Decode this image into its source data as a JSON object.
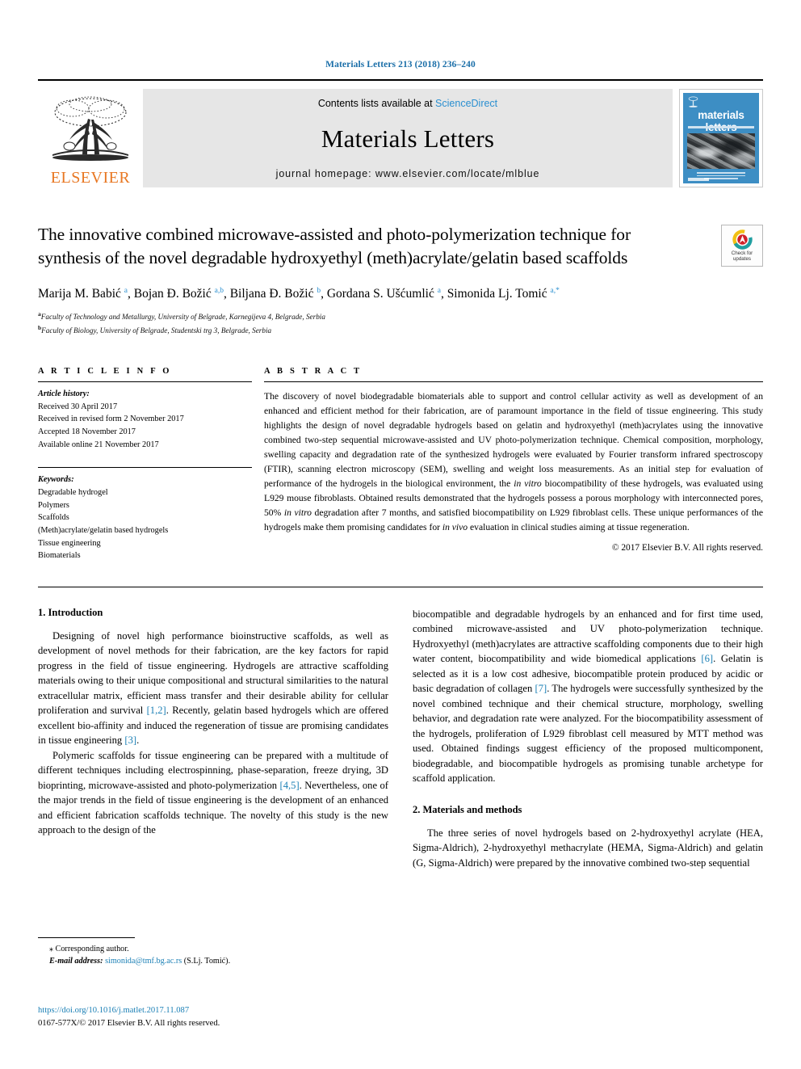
{
  "running_head": "Materials Letters 213 (2018) 236–240",
  "masthead": {
    "publisher_wordmark": "ELSEVIER",
    "contents_prefix": "Contents lists available at ",
    "contents_link": "ScienceDirect",
    "journal_title": "Materials Letters",
    "homepage": "journal homepage: www.elsevier.com/locate/mlblue",
    "cover_title": "materials letters",
    "link_color": "#2a8fd0",
    "elsevier_orange": "#e87722"
  },
  "crossmark": {
    "line1": "Check for",
    "line2": "updates"
  },
  "article": {
    "title": "The innovative combined microwave-assisted and photo-polymerization technique for synthesis of the novel degradable hydroxyethyl (meth)acrylate/gelatin based scaffolds",
    "authors_html": "Marija M. Babić <sup>a</sup>, Bojan Đ. Božić <sup>a,b</sup>, Biljana Đ. Božić <sup>b</sup>, Gordana S. Ušćumlić <sup>a</sup>, Simonida Lj. Tomić <sup>a,*</sup>",
    "affiliation_a": "Faculty of Technology and Metallurgy, University of Belgrade, Karnegijeva 4, Belgrade, Serbia",
    "affiliation_b": "Faculty of Biology, University of Belgrade, Studentski trg 3, Belgrade, Serbia",
    "affil_marker_a": "a",
    "affil_marker_b": "b"
  },
  "article_info": {
    "heading": "A R T I C L E   I N F O",
    "history_label": "Article history:",
    "history": [
      "Received 30 April 2017",
      "Received in revised form 2 November 2017",
      "Accepted 18 November 2017",
      "Available online 21 November 2017"
    ],
    "keywords_label": "Keywords:",
    "keywords": [
      "Degradable hydrogel",
      "Polymers",
      "Scaffolds",
      "(Meth)acrylate/gelatin based hydrogels",
      "Tissue engineering",
      "Biomaterials"
    ]
  },
  "abstract": {
    "heading": "A B S T R A C T",
    "text_html": "The discovery of novel biodegradable biomaterials able to support and control cellular activity as well as development of an enhanced and efficient method for their fabrication, are of paramount importance in the field of tissue engineering. This study highlights the design of novel degradable hydrogels based on gelatin and hydroxyethyl (meth)acrylates using the innovative combined two-step sequential microwave-assisted and UV photo-polymerization technique. Chemical composition, morphology, swelling capacity and degradation rate of the synthesized hydrogels were evaluated by Fourier transform infrared spectroscopy (FTIR), scanning electron microscopy (SEM), swelling and weight loss measurements. As an initial step for evaluation of performance of the hydrogels in the biological environment, the <em>in vitro</em> biocompatibility of these hydrogels, was evaluated using L929 mouse fibroblasts. Obtained results demonstrated that the hydrogels possess a porous morphology with interconnected pores, 50% <em>in vitro</em> degradation after 7 months, and satisfied biocompatibility on L929 fibroblast cells. These unique performances of the hydrogels make them promising candidates for <em>in vivo</em> evaluation in clinical studies aiming at tissue regeneration.",
    "copyright": "© 2017 Elsevier B.V. All rights reserved."
  },
  "body": {
    "intro_heading": "1. Introduction",
    "intro_p1_html": "Designing of novel high performance bioinstructive scaffolds, as well as development of novel methods for their fabrication, are the key factors for rapid progress in the field of tissue engineering. Hydrogels are attractive scaffolding materials owing to their unique compositional and structural similarities to the natural extracellular matrix, efficient mass transfer and their desirable ability for cellular proliferation and survival <span class=\"ref\">[1,2]</span>. Recently, gelatin based hydrogels which are offered excellent bio-affinity and induced the regeneration of tissue are promising candidates in tissue engineering <span class=\"ref\">[3]</span>.",
    "intro_p2_html": "Polymeric scaffolds for tissue engineering can be prepared with a multitude of different techniques including electrospinning, phase-separation, freeze drying, 3D bioprinting, microwave-assisted and photo-polymerization <span class=\"ref\">[4,5]</span>. Nevertheless, one of the major trends in the field of tissue engineering is the development of an enhanced and efficient fabrication scaffolds technique. The novelty of this study is the new approach to the design of the",
    "intro_p3_html": "biocompatible and degradable hydrogels by an enhanced and for first time used, combined microwave-assisted and UV photo-polymerization technique. Hydroxyethyl (meth)acrylates are attractive scaffolding components due to their high water content, biocompatibility and wide biomedical applications <span class=\"ref\">[6]</span>. Gelatin is selected as it is a low cost adhesive, biocompatible protein produced by acidic or basic degradation of collagen <span class=\"ref\">[7]</span>. The hydrogels were successfully synthesized by the novel combined technique and their chemical structure, morphology, swelling behavior, and degradation rate were analyzed. For the biocompatibility assessment of the hydrogels, proliferation of L929 fibroblast cell measured by MTT method was used. Obtained findings suggest efficiency of the proposed multicomponent, biodegradable, and biocompatible hydrogels as promising tunable archetype for scaffold application.",
    "methods_heading": "2. Materials and methods",
    "methods_p1_html": "The three series of novel hydrogels based on 2-hydroxyethyl acrylate (HEA, Sigma-Aldrich), 2-hydroxyethyl methacrylate (HEMA, Sigma-Aldrich) and gelatin (G, Sigma-Aldrich) were prepared by the innovative combined two-step sequential"
  },
  "footnotes": {
    "corresponding_star": "⁎",
    "corresponding_label": "Corresponding author.",
    "email_label": "E-mail address:",
    "email": "simonida@tmf.bg.ac.rs",
    "email_owner": "(S.Lj. Tomić).",
    "doi": "https://doi.org/10.1016/j.matlet.2017.11.087",
    "issn_line": "0167-577X/© 2017 Elsevier B.V. All rights reserved."
  }
}
